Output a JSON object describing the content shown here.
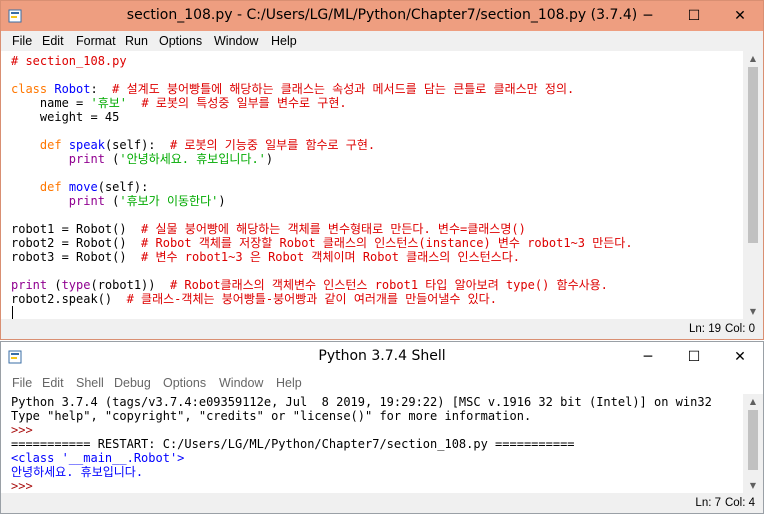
{
  "editor_window": {
    "title": "section_108.py - C:/Users/LG/ML/Python/Chapter7/section_108.py (3.7.4)",
    "controls": {
      "minimize": "─",
      "maximize": "☐",
      "close": "✕"
    },
    "menu": [
      "File",
      "Edit",
      "Format",
      "Run",
      "Options",
      "Window",
      "Help"
    ],
    "code": {
      "l1": "# section_108.py",
      "l3_kw": "class",
      "l3_def": "Robot",
      "l3_rest": ":",
      "l3_cmt": "  # 설계도 붕어빵틀에 해당하는 클래스는 속성과 메서드를 담는 큰틀로 클래스만 정의.",
      "l4_a": "    name = ",
      "l4_str": "'휴보'",
      "l4_cmt": "  # 로봇의 특성중 일부를 변수로 구현.",
      "l5": "    weight = 45",
      "l7_ind": "    ",
      "l7_kw": "def",
      "l7_sp": " ",
      "l7_def": "speak",
      "l7_rest": "(self):",
      "l7_cmt": "  # 로봇의 기능중 일부를 함수로 구현.",
      "l8_ind": "        ",
      "l8_blt": "print",
      "l8_a": " (",
      "l8_str": "'안녕하세요. 휴보입니다.'",
      "l8_b": ")",
      "l10_ind": "    ",
      "l10_kw": "def",
      "l10_sp": " ",
      "l10_def": "move",
      "l10_rest": "(self):",
      "l11_ind": "        ",
      "l11_blt": "print",
      "l11_a": " (",
      "l11_str": "'휴보가 이동한다'",
      "l11_b": ")",
      "l13_a": "robot1 = Robot()",
      "l13_cmt": "  # 실물 붕어빵에 해당하는 객체를 변수형태로 만든다. 변수=클래스명()",
      "l14_a": "robot2 = Robot()",
      "l14_cmt": "  # Robot 객체를 저장할 Robot 클래스의 인스턴스(instance) 변수 robot1~3 만든다.",
      "l15_a": "robot3 = Robot()",
      "l15_cmt": "  # 변수 robot1~3 은 Robot 객체이며 Robot 클래스의 인스턴스다.",
      "l17_blt1": "print",
      "l17_a": " (",
      "l17_blt2": "type",
      "l17_b": "(robot1))",
      "l17_cmt": "  # Robot클래스의 객체변수 인스턴스 robot1 타입 알아보려 type() 함수사용.",
      "l18_a": "robot2.speak()",
      "l18_cmt": "  # 클래스-객체는 붕어빵틀-붕어빵과 같이 여러개를 만들어낼수 있다."
    },
    "status": {
      "line": "Ln: 19",
      "col": "Col: 0"
    }
  },
  "shell_window": {
    "title": "Python 3.7.4 Shell",
    "controls": {
      "minimize": "─",
      "maximize": "☐",
      "close": "✕"
    },
    "menu": [
      "File",
      "Edit",
      "Shell",
      "Debug",
      "Options",
      "Window",
      "Help"
    ],
    "lines": {
      "s1": "Python 3.7.4 (tags/v3.7.4:e09359112e, Jul  8 2019, 19:29:22) [MSC v.1916 32 bit (Intel)] on win32",
      "s2": "Type \"help\", \"copyright\", \"credits\" or \"license()\" for more information.",
      "s3": ">>> ",
      "s4": "=========== RESTART: C:/Users/LG/ML/Python/Chapter7/section_108.py ===========",
      "s5": "<class '__main__.Robot'>",
      "s6": "안녕하세요. 휴보입니다.",
      "s7": ">>> "
    },
    "status": {
      "line": "Ln: 7",
      "col": "Col: 4"
    }
  }
}
